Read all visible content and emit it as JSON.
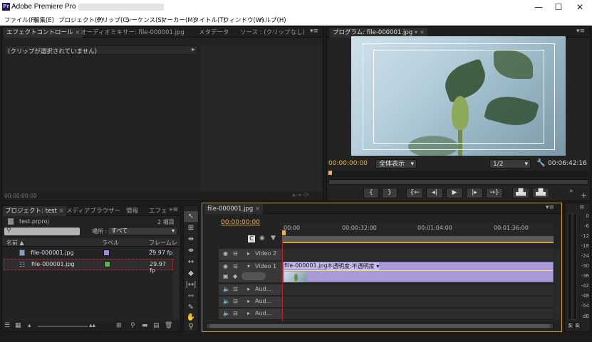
{
  "window": {
    "title": "Adobe Premiere Pro - ",
    "logo": "Pr",
    "controls": [
      "minimize-icon",
      "maximize-icon",
      "close-icon"
    ]
  },
  "menu": [
    "ファイル(F)",
    "編集(E)",
    "プロジェクト(P)",
    "クリップ(C)",
    "シーケンス(S)",
    "マーカー(M)",
    "タイトル(T)",
    "ウィンドウ(W)",
    "ヘルプ(H)"
  ],
  "effects": {
    "tabs": [
      "エフェクトコントロール",
      "オーディオミキサー: file-000001.jpg",
      "メタデータ",
      "ソース : (クリップなし)"
    ],
    "no_clip": "(クリップが選択されていません)",
    "timecode": "00:00:00:00"
  },
  "program": {
    "tab": "プログラム: file-000001.jpg",
    "timecode": "00:00:00:00",
    "fit": "全体表示",
    "resolution": "1/2",
    "duration": "00:06:42:16"
  },
  "project": {
    "tabs": [
      "プロジェクト: test",
      "メディアブラウザー",
      "情報",
      "エフェ"
    ],
    "file": "test.prproj",
    "count": "2 項目",
    "location_label": "場所 :",
    "location_value": "すべて",
    "columns": [
      "名前",
      "ラベル",
      "フレームレー"
    ],
    "rows": [
      {
        "name": "file-000001.jpg",
        "fps": "29.97 fps",
        "label_color": "#9d8ed4"
      },
      {
        "name": "file-000001.jpg",
        "fps": "29.97 fp",
        "label_color": "#52b84c"
      }
    ]
  },
  "timeline": {
    "tab": "file-000001.jpg",
    "timecode": "00:00:00:00",
    "ruler": [
      "00:00",
      "00:00:32:00",
      "00:01:04:00",
      "00:01:36:00"
    ],
    "tracks": {
      "video2": "Video 2",
      "video1": "Video 1",
      "audio": [
        "Aud...",
        "Aud...",
        "Aud..."
      ]
    },
    "clip": "file-000001.jpg",
    "clip_effect": "不透明度:不透明度"
  },
  "meter": {
    "scale": [
      "0",
      "-6",
      "-12",
      "-18",
      "-24",
      "-30",
      "-36",
      "-42",
      "-48",
      "-54",
      "dB"
    ],
    "solo": [
      "S",
      "S"
    ]
  }
}
